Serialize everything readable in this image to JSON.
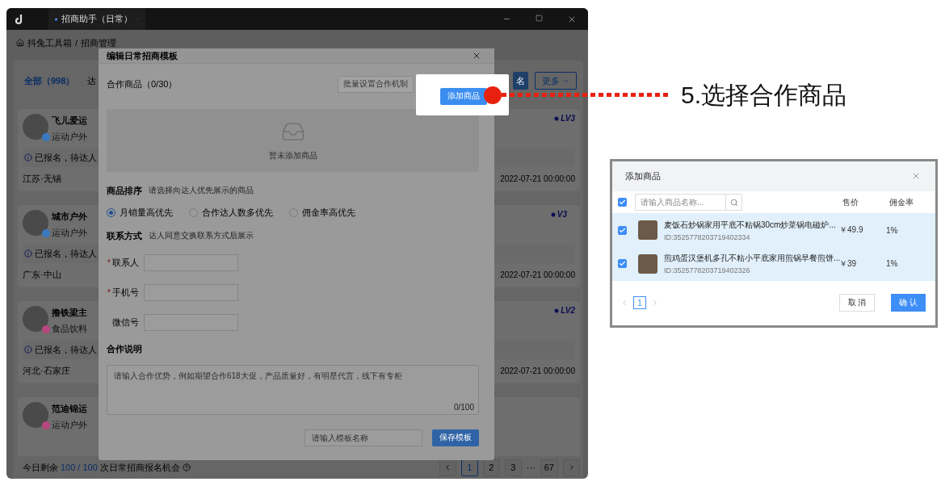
{
  "app_window": {
    "tab_title": "招商助手（日常）",
    "breadcrumb": {
      "items": [
        "抖兔工具箱",
        "招商管理"
      ],
      "separator": "/"
    },
    "filter_tabs": [
      {
        "label": "全部（998）",
        "selected": true
      },
      {
        "label": "达",
        "selected": false
      }
    ],
    "actions": {
      "primary": "名",
      "more": "更多"
    },
    "creators": [
      {
        "name": "飞儿爱运",
        "category": "运动户外",
        "status": "已报名，待达人",
        "location": "江苏·无锡",
        "level": "LV3",
        "date": "2022-07-21 00:00:00",
        "color": "#3a78c2"
      },
      {
        "name": "城市户外",
        "category": "运动户外",
        "status": "已报名，待达人",
        "location": "广东·中山",
        "level": "V3",
        "date": "2022-07-21 00:00:00",
        "color": "#3a78c2"
      },
      {
        "name": "撸铁梁主",
        "category": "食品饮料",
        "status": "已报名，待达人",
        "location": "河北·石家庄",
        "level": "LV2",
        "date": "2022-07-21 00:00:00",
        "color": "#b8467e"
      },
      {
        "name": "范迪锦运",
        "category": "运动户外",
        "color": "#b8467e"
      }
    ],
    "quota": {
      "label": "今日剩余",
      "remaining": "100",
      "separator": "/",
      "total": "100",
      "suffix": "次日常招商报名机会"
    },
    "pagination": [
      {
        "kind": "page",
        "label": "1",
        "selected": true
      },
      {
        "kind": "page",
        "label": "2",
        "selected": false
      },
      {
        "kind": "page",
        "label": "3",
        "selected": false
      },
      {
        "kind": "ellipsis",
        "label": "···"
      },
      {
        "kind": "page",
        "label": "67",
        "selected": false
      }
    ]
  },
  "template_dialog": {
    "title": "编辑日常招商模板",
    "products_label": "合作商品（0/30）",
    "batch_button": "批量设置合作机制",
    "add_button": "添加商品",
    "empty_text": "暂未添加商品",
    "sort": {
      "label": "商品排序",
      "hint": "请选择向达人优先展示的商品",
      "options": [
        {
          "label": "月销量高优先",
          "selected": true
        },
        {
          "label": "合作达人数多优先",
          "selected": false
        },
        {
          "label": "佣金率高优先",
          "selected": false
        }
      ]
    },
    "contact": {
      "label": "联系方式",
      "hint": "达人同意交换联系方式后展示",
      "fields": [
        {
          "label": "联系人",
          "required_mark": "*"
        },
        {
          "label": "手机号",
          "required_mark": "*"
        },
        {
          "label": "微信号"
        }
      ]
    },
    "notes": {
      "label": "合作说明",
      "placeholder": "请输入合作优势，例如期望合作618大促，产品质量好，有明星代言，线下有专柜",
      "counter": "0/100"
    },
    "template_name_placeholder": "请输入模板名称",
    "save_button": "保存模板"
  },
  "callout": {
    "text": "5.选择合作商品"
  },
  "add_products_dialog": {
    "title": "添加商品",
    "select_all": true,
    "search_placeholder": "请输入商品名称...",
    "columns": [
      "售价",
      "佣金率"
    ],
    "products": [
      {
        "name": "麦饭石炒锅家用平底不粘锅30cm炒菜锅电磁炉...",
        "id": "ID:3525778203719402334",
        "price": "￥49.9",
        "commission": "1%",
        "checked": true
      },
      {
        "name": "煎鸡蛋汉堡机多孔不粘小平底家用煎锅早餐煎饼...",
        "id": "ID:3525778203719402326",
        "price": "￥39",
        "commission": "1%",
        "checked": true
      }
    ],
    "pages": [
      {
        "label": "1",
        "selected": true
      }
    ],
    "cancel": "取 消",
    "confirm": "确 认"
  }
}
